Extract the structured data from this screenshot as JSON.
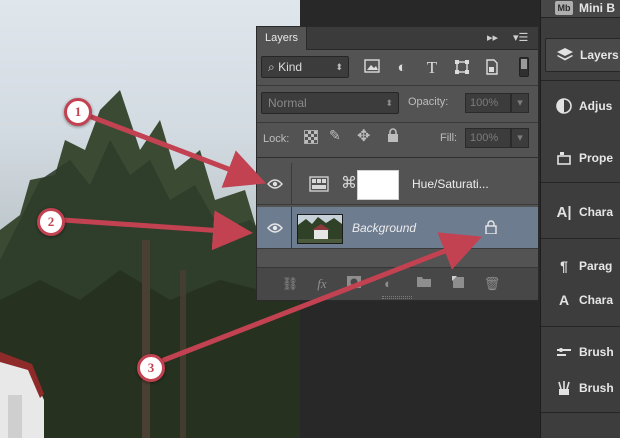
{
  "side_panel": {
    "items": [
      {
        "label": "Mini B",
        "icon": "mini-bridge-icon"
      },
      {
        "label": "Layers",
        "icon": "layers-icon",
        "active": true
      },
      {
        "label": "Adjus",
        "icon": "adjustments-icon"
      },
      {
        "label": "Prope",
        "icon": "properties-icon"
      },
      {
        "label": "Chara",
        "icon": "character-icon"
      },
      {
        "label": "Parag",
        "icon": "paragraph-icon"
      },
      {
        "label": "Chara",
        "icon": "character-styles-icon"
      },
      {
        "label": "Brush",
        "icon": "brush-icon"
      },
      {
        "label": "Brush",
        "icon": "brush-presets-icon"
      }
    ],
    "mini_badge": "Mb"
  },
  "layers_panel": {
    "tab_label": "Layers",
    "filter_kind": "Kind",
    "blend_mode": "Normal",
    "opacity_label": "Opacity:",
    "opacity_value": "100%",
    "lock_label": "Lock:",
    "fill_label": "Fill:",
    "fill_value": "100%",
    "layers": [
      {
        "name": "Hue/Saturati...",
        "type": "adjustment",
        "visible": true,
        "selected": false
      },
      {
        "name": "Background",
        "type": "image",
        "visible": true,
        "selected": true,
        "locked": true
      }
    ],
    "footer_icons": [
      "link-layers-icon",
      "fx-icon",
      "add-mask-icon",
      "new-adjustment-icon",
      "new-group-icon",
      "new-layer-icon",
      "delete-icon"
    ],
    "footer_fx": "fx"
  },
  "annotations": [
    {
      "number": "1"
    },
    {
      "number": "2"
    },
    {
      "number": "3"
    }
  ],
  "colors": {
    "arrow": "#c24252",
    "selected_layer": "#6e7c90",
    "panel": "#535353"
  }
}
